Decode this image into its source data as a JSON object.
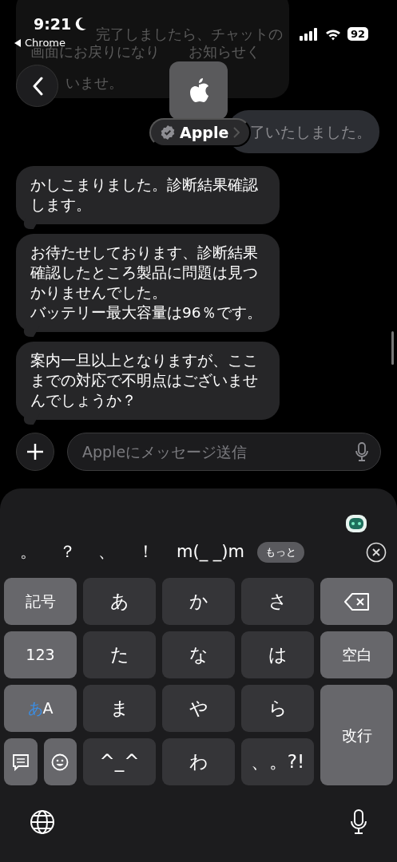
{
  "status_bar": {
    "time": "9:21",
    "back_app": "Chrome",
    "battery": "92"
  },
  "background_bubble": {
    "lines": [
      "完了しましたら、チャットの",
      "画面にお戻りになり",
      "お知らせく",
      "いませ。"
    ]
  },
  "header": {
    "contact": "Apple",
    "verified": true
  },
  "messages": [
    {
      "kind": "outgoing",
      "paragraphs": [
        "了いたしました。"
      ]
    },
    {
      "kind": "incoming",
      "paragraphs": [
        "かしこまりました。診断結果確認します。"
      ]
    },
    {
      "kind": "incoming",
      "paragraphs": [
        "お待たせしております、診断結果確認したところ製品に問題は見つかりませんでした。",
        "バッテリー最大容量は96％です。"
      ]
    },
    {
      "kind": "incoming",
      "paragraphs": [
        "案内一旦以上となりますが、ここまでの対応で不明点はございませんでしょうか？"
      ]
    }
  ],
  "composer": {
    "placeholder": "Appleにメッセージ送信"
  },
  "keyboard": {
    "suggestions": [
      "。",
      "？",
      "、",
      "！",
      "m(_ _)m"
    ],
    "more": "もっと",
    "keys": [
      {
        "kind": "function",
        "label": "記号"
      },
      {
        "kind": "kana",
        "label": "あ"
      },
      {
        "kind": "kana",
        "label": "か"
      },
      {
        "kind": "kana",
        "label": "さ"
      },
      {
        "kind": "delete"
      },
      {
        "kind": "function",
        "label": "123"
      },
      {
        "kind": "kana",
        "label": "た"
      },
      {
        "kind": "kana",
        "label": "な"
      },
      {
        "kind": "kana",
        "label": "は"
      },
      {
        "kind": "function",
        "label": "空白"
      },
      {
        "kind": "mode",
        "options": [
          {
            "label": "あ",
            "selected": true
          },
          {
            "label": "A",
            "selected": false
          }
        ]
      },
      {
        "kind": "kana",
        "label": "ま"
      },
      {
        "kind": "kana",
        "label": "や"
      },
      {
        "kind": "kana",
        "label": "ら"
      },
      {
        "kind": "return",
        "label": "改行"
      },
      {
        "kind": "tools"
      },
      {
        "kind": "kana",
        "label": "^_^"
      },
      {
        "kind": "kana",
        "label": "わ"
      },
      {
        "kind": "kana",
        "label": "、。?!"
      }
    ]
  }
}
